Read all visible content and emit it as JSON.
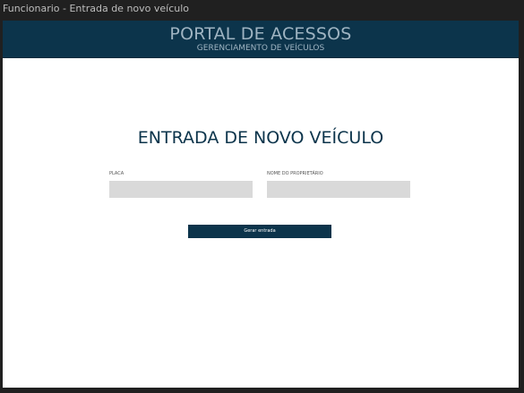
{
  "window": {
    "title": "Funcionario - Entrada de novo veículo"
  },
  "header": {
    "title": "PORTAL DE ACESSOS",
    "subtitle": "GERENCIAMENTO DE VEÍCULOS"
  },
  "main": {
    "title": "ENTRADA DE NOVO VEÍCULO",
    "placa": {
      "label": "PLACA",
      "value": ""
    },
    "proprietario": {
      "label": "NOME DO PROPRIETÁRIO",
      "value": ""
    },
    "submit_label": "Gerar entrada"
  },
  "colors": {
    "header_bg": "#0c344b",
    "header_text": "#9fb4c2",
    "input_bg": "#d9d9d9",
    "button_bg": "#0c344b"
  }
}
